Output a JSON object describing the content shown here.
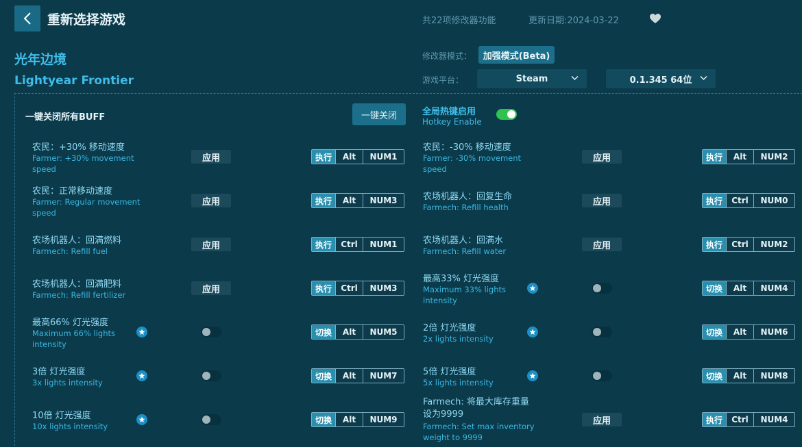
{
  "header": {
    "title": "重新选择游戏",
    "feature_count": "共22项修改器功能",
    "update_date": "更新日期:2024-03-22"
  },
  "game": {
    "name_cn": "光年边境",
    "name_en": "Lightyear Frontier"
  },
  "settings": {
    "mode_label": "修改器模式：",
    "mode_value": "加强模式(Beta)",
    "platform_label": "游戏平台：",
    "platform_value": "Steam",
    "version_value": "0.1.345 64位"
  },
  "controls": {
    "close_all_label": "一键关闭所有BUFF",
    "close_all_button": "一键关闭",
    "hotkey_cn": "全局热键启用",
    "hotkey_en": "Hotkey Enable",
    "hotkey_enabled": true
  },
  "features": [
    {
      "cn": "农民：+30% 移动速度",
      "en": "Farmer: +30% movement speed",
      "control": "apply",
      "label": "应用",
      "action": "执行",
      "mod": "Alt",
      "key": "NUM1",
      "star": false
    },
    {
      "cn": "农民：-30% 移动速度",
      "en": "Farmer: -30% movement speed",
      "control": "apply",
      "label": "应用",
      "action": "执行",
      "mod": "Alt",
      "key": "NUM2",
      "star": false
    },
    {
      "cn": "农民：正常移动速度",
      "en": "Farmer: Regular movement speed",
      "control": "apply",
      "label": "应用",
      "action": "执行",
      "mod": "Alt",
      "key": "NUM3",
      "star": false
    },
    {
      "cn": "农场机器人：回复生命",
      "en": "Farmech: Refill health",
      "control": "apply",
      "label": "应用",
      "action": "执行",
      "mod": "Ctrl",
      "key": "NUM0",
      "star": false
    },
    {
      "cn": "农场机器人：回满燃料",
      "en": "Farmech: Refill fuel",
      "control": "apply",
      "label": "应用",
      "action": "执行",
      "mod": "Ctrl",
      "key": "NUM1",
      "star": false
    },
    {
      "cn": "农场机器人：回满水",
      "en": "Farmech: Refill water",
      "control": "apply",
      "label": "应用",
      "action": "执行",
      "mod": "Ctrl",
      "key": "NUM2",
      "star": false
    },
    {
      "cn": "农场机器人：回满肥料",
      "en": "Farmech: Refill fertilizer",
      "control": "apply",
      "label": "应用",
      "action": "执行",
      "mod": "Ctrl",
      "key": "NUM3",
      "star": false
    },
    {
      "cn": "最高33% 灯光强度",
      "en": "Maximum 33% lights intensity",
      "control": "toggle",
      "label": "",
      "action": "切换",
      "mod": "Alt",
      "key": "NUM4",
      "star": true
    },
    {
      "cn": "最高66% 灯光强度",
      "en": "Maximum 66% lights intensity",
      "control": "toggle",
      "label": "",
      "action": "切换",
      "mod": "Alt",
      "key": "NUM5",
      "star": true
    },
    {
      "cn": "2倍 灯光强度",
      "en": "2x lights intensity",
      "control": "toggle",
      "label": "",
      "action": "切换",
      "mod": "Alt",
      "key": "NUM6",
      "star": true
    },
    {
      "cn": "3倍 灯光强度",
      "en": "3x lights intensity",
      "control": "toggle",
      "label": "",
      "action": "切换",
      "mod": "Alt",
      "key": "NUM7",
      "star": true
    },
    {
      "cn": "5倍 灯光强度",
      "en": "5x lights intensity",
      "control": "toggle",
      "label": "",
      "action": "切换",
      "mod": "Alt",
      "key": "NUM8",
      "star": true
    },
    {
      "cn": "10倍 灯光强度",
      "en": "10x lights intensity",
      "control": "toggle",
      "label": "",
      "action": "切换",
      "mod": "Alt",
      "key": "NUM9",
      "star": true
    },
    {
      "cn": "Farmech: 将最大库存重量设为9999",
      "en": "Farmech: Set max inventory weight to 9999",
      "control": "apply",
      "label": "应用",
      "action": "执行",
      "mod": "Ctrl",
      "key": "NUM4",
      "star": false
    }
  ]
}
